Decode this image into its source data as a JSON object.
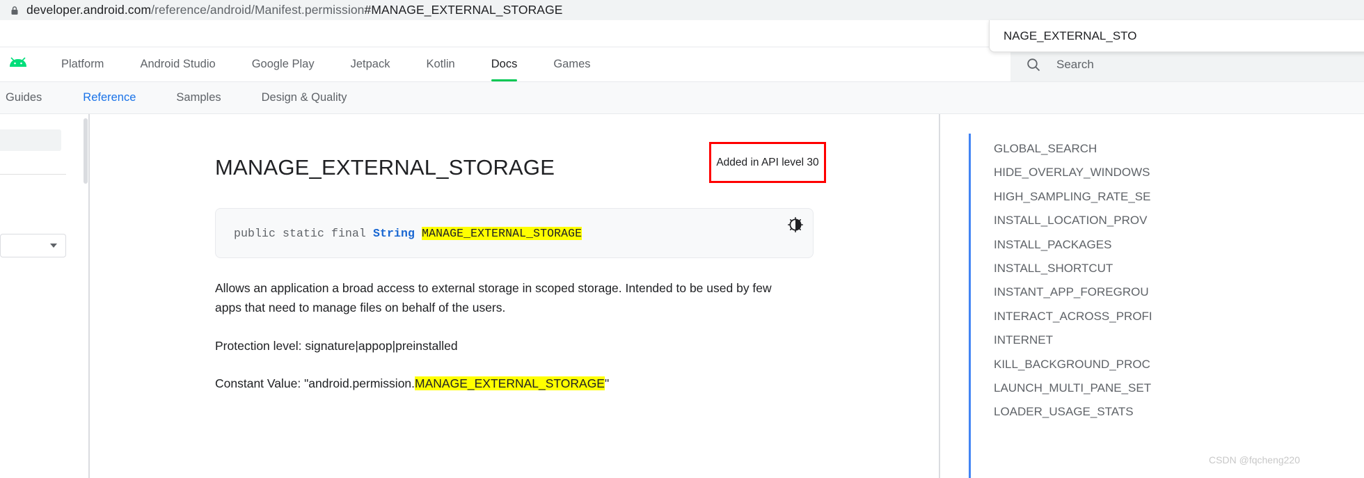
{
  "browser": {
    "lock_icon": "lock-icon",
    "url_domain": "developer.android.com",
    "url_path": "/reference/android/Manifest.permission",
    "url_fragment": "#MANAGE_EXTERNAL_STORAGE",
    "popup_text": "\u0001NAGE_EXTERNAL_STO"
  },
  "topnav": {
    "logo": "android-logo-icon",
    "items": [
      {
        "label": "Platform",
        "active": false
      },
      {
        "label": "Android Studio",
        "active": false
      },
      {
        "label": "Google Play",
        "active": false
      },
      {
        "label": "Jetpack",
        "active": false
      },
      {
        "label": "Kotlin",
        "active": false
      },
      {
        "label": "Docs",
        "active": true
      },
      {
        "label": "Games",
        "active": false
      }
    ],
    "search": {
      "icon": "search-icon",
      "placeholder": "Search",
      "value": ""
    }
  },
  "subnav": {
    "items": [
      {
        "label": "Guides",
        "active": false
      },
      {
        "label": "Reference",
        "active": true
      },
      {
        "label": "Samples",
        "active": false
      },
      {
        "label": "Design & Quality",
        "active": false
      }
    ]
  },
  "main": {
    "title": "MANAGE_EXTERNAL_STORAGE",
    "api_badge": "Added in API level 30",
    "api_badge_border_color": "#ff0000",
    "code": {
      "modifiers": "public static final ",
      "type": "String",
      "name": "MANAGE_EXTERNAL_STORAGE",
      "theme_icon": "contrast-theme-icon"
    },
    "description": "Allows an application a broad access to external storage in scoped storage. Intended to be used by few apps that need to manage files on behalf of the users.",
    "protection_level_label": "Protection level: ",
    "protection_level_value": "signature|appop|preinstalled",
    "constant_value_label": "Constant Value: ",
    "constant_value_prefix": "\"android.permission.",
    "constant_value_highlight": "MANAGE_EXTERNAL_STORAGE",
    "constant_value_suffix": "\"",
    "highlight_color": "#ffff00"
  },
  "right_sidebar": {
    "accent_color": "#4285f4",
    "items": [
      "GLOBAL_SEARCH",
      "HIDE_OVERLAY_WINDOWS",
      "HIGH_SAMPLING_RATE_SE",
      "INSTALL_LOCATION_PROV",
      "INSTALL_PACKAGES",
      "INSTALL_SHORTCUT",
      "INSTANT_APP_FOREGROU",
      "INTERACT_ACROSS_PROFI",
      "INTERNET",
      "KILL_BACKGROUND_PROC",
      "LAUNCH_MULTI_PANE_SET",
      "LOADER_USAGE_STATS"
    ],
    "watermark": "CSDN @fqcheng220"
  }
}
